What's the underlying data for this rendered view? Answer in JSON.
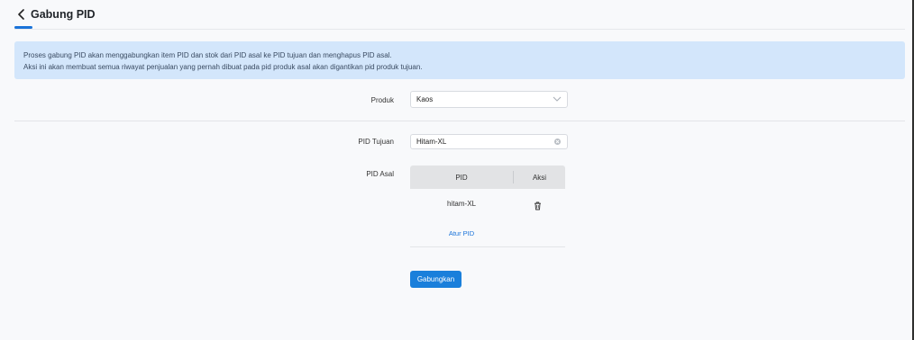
{
  "header": {
    "title": "Gabung PID",
    "back_icon": "chevron-left-icon"
  },
  "banner": {
    "line1": "Proses gabung PID akan menggabungkan item PID dan stok dari PID asal ke PID tujuan dan menghapus PID asal.",
    "line2": "Aksi ini akan membuat semua riwayat penjualan yang pernah dibuat pada pid produk asal akan digantikan pid produk tujuan."
  },
  "form": {
    "produk_label": "Produk",
    "produk_value": "Kaos",
    "pid_tujuan_label": "PID Tujuan",
    "pid_tujuan_value": "Hitam-XL",
    "pid_asal_label": "PID Asal"
  },
  "table": {
    "columns": [
      "PID",
      "Aksi"
    ],
    "rows": [
      {
        "pid": "hitam-XL"
      }
    ],
    "link_label": "Atur PID"
  },
  "actions": {
    "submit_label": "Gabungkan"
  },
  "colors": {
    "accent": "#1a73d9",
    "banner_bg": "#d3e6fb"
  }
}
